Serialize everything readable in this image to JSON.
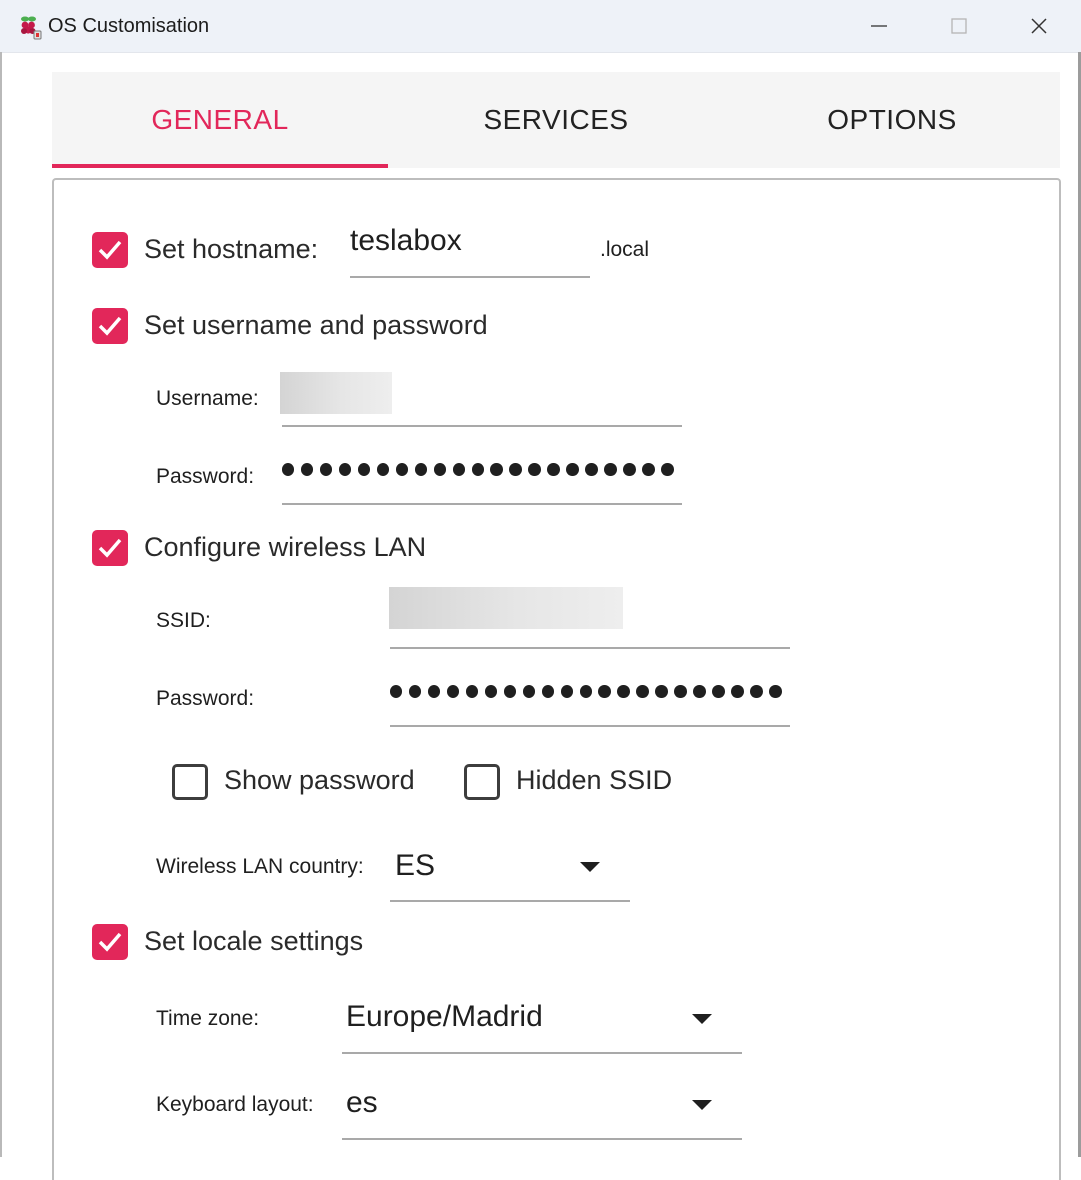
{
  "window": {
    "title": "OS Customisation",
    "icon": "raspberry-pi-icon",
    "controls": [
      "minimize-icon",
      "maximize-icon",
      "close-icon"
    ]
  },
  "tabs": [
    {
      "label": "GENERAL",
      "active": true
    },
    {
      "label": "SERVICES",
      "active": false
    },
    {
      "label": "OPTIONS",
      "active": false
    }
  ],
  "accent_color": "#e2275a",
  "hostname": {
    "label": "Set hostname:",
    "value": "teslabox",
    "suffix": ".local",
    "checked": true
  },
  "user": {
    "label": "Set username and password",
    "checked": true,
    "username_label": "Username:",
    "username_value": "",
    "password_label": "Password:"
  },
  "wlan": {
    "label": "Configure wireless LAN",
    "checked": true,
    "ssid_label": "SSID:",
    "ssid_value": "",
    "password_label": "Password:",
    "show_password": {
      "label": "Show password",
      "checked": false
    },
    "hidden_ssid": {
      "label": "Hidden SSID",
      "checked": false
    },
    "country_label": "Wireless LAN country:",
    "country_value": "ES"
  },
  "locale": {
    "label": "Set locale settings",
    "checked": true,
    "timezone_label": "Time zone:",
    "timezone_value": "Europe/Madrid",
    "keyboard_label": "Keyboard layout:",
    "keyboard_value": "es"
  }
}
